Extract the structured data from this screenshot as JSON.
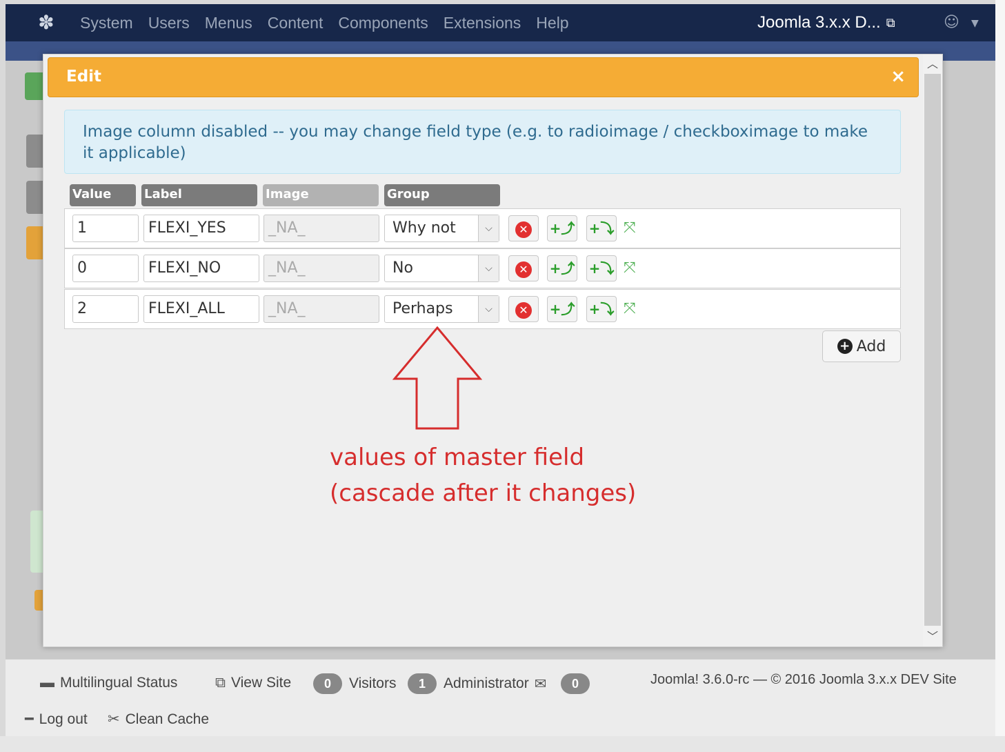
{
  "navbar": {
    "menu": [
      "System",
      "Users",
      "Menus",
      "Content",
      "Components",
      "Extensions",
      "Help"
    ],
    "site_name": "Joomla 3.x.x D...",
    "icons": {
      "logo": "joomla-logo-icon",
      "external": "external-link-icon",
      "user": "user-icon"
    }
  },
  "modal": {
    "title": "Edit",
    "close": "×",
    "info": "Image column disabled -- you may change field type (e.g. to radioimage / checkboximage to make it applicable)",
    "columns": {
      "value": "Value",
      "label": "Label",
      "image": "Image",
      "group": "Group"
    },
    "rows": [
      {
        "value": "1",
        "label": "FLEXI_YES",
        "image": "_NA_",
        "group": "Why not"
      },
      {
        "value": "0",
        "label": "FLEXI_NO",
        "image": "_NA_",
        "group": "No"
      },
      {
        "value": "2",
        "label": "FLEXI_ALL",
        "image": "_NA_",
        "group": "Perhaps"
      }
    ],
    "add_label": "Add",
    "annotation_line1": "values of master field",
    "annotation_line2": "(cascade after it changes)"
  },
  "footer": {
    "multilingual": "Multilingual Status",
    "view_site": "View Site",
    "visitors_count": "0",
    "visitors_label": "Visitors",
    "admin_count": "1",
    "admin_label": "Administrator",
    "messages_count": "0",
    "logout": "Log out",
    "clean_cache": "Clean Cache",
    "version": "Joomla! 3.6.0-rc  —  © 2016 Joomla 3.x.x DEV Site"
  },
  "colors": {
    "navbar": "#17274a",
    "modal_header": "#f5ac35",
    "info_bg": "#dff0f8",
    "annotation": "#d62d2d"
  }
}
